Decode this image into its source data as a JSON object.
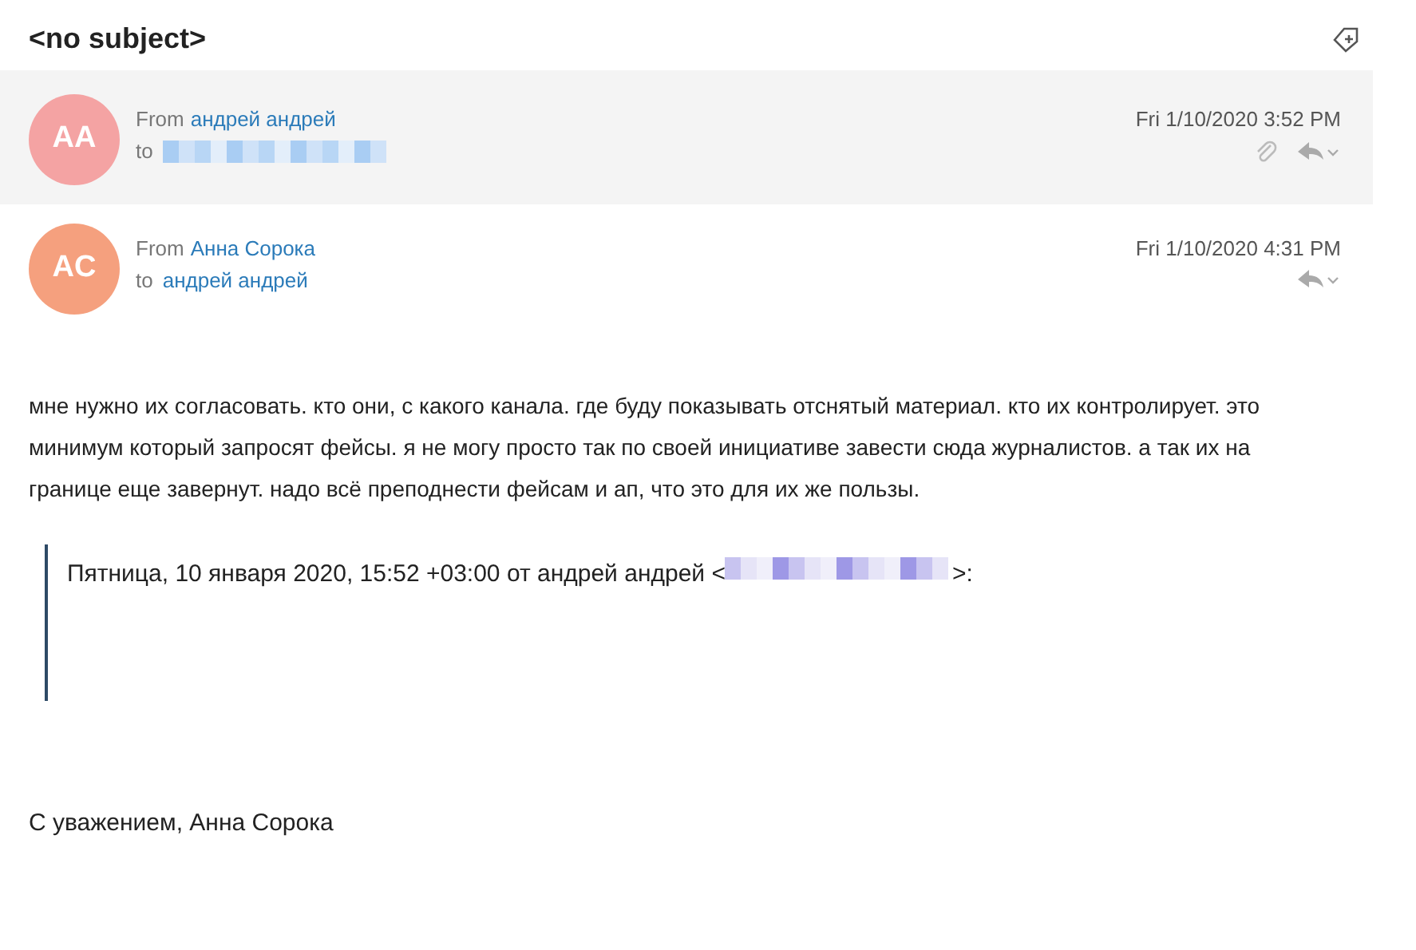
{
  "subject": "<no subject>",
  "messages": [
    {
      "initials": "AA",
      "color": "#f4a3a3",
      "from_label": "From",
      "sender": "андрей андрей",
      "to_label": "to",
      "recipient": {
        "kind": "redacted"
      },
      "date": "Fri 1/10/2020 3:52 PM",
      "has_attachment": true,
      "selected": true
    },
    {
      "initials": "AC",
      "color": "#f5a07e",
      "from_label": "From",
      "sender": "Анна Сорока",
      "to_label": "to",
      "recipient": {
        "kind": "name",
        "text": "андрей андрей"
      },
      "date": "Fri 1/10/2020 4:31 PM",
      "has_attachment": false,
      "selected": false
    }
  ],
  "body": "мне нужно их согласовать. кто они, с какого канала. где буду показывать отснятый материал. кто их контролирует. это минимум который запросят фейсы. я не могу просто так по своей инициативе завести сюда журналистов. а так их на границе еще завернут. надо всё преподнести фейсам и ап, что это для их же пользы.",
  "quote": {
    "before": "Пятница, 10 января 2020, 15:52 +03:00 от андрей андрей <",
    "after": ">:"
  },
  "signature": "С уважением, Анна Сорока"
}
